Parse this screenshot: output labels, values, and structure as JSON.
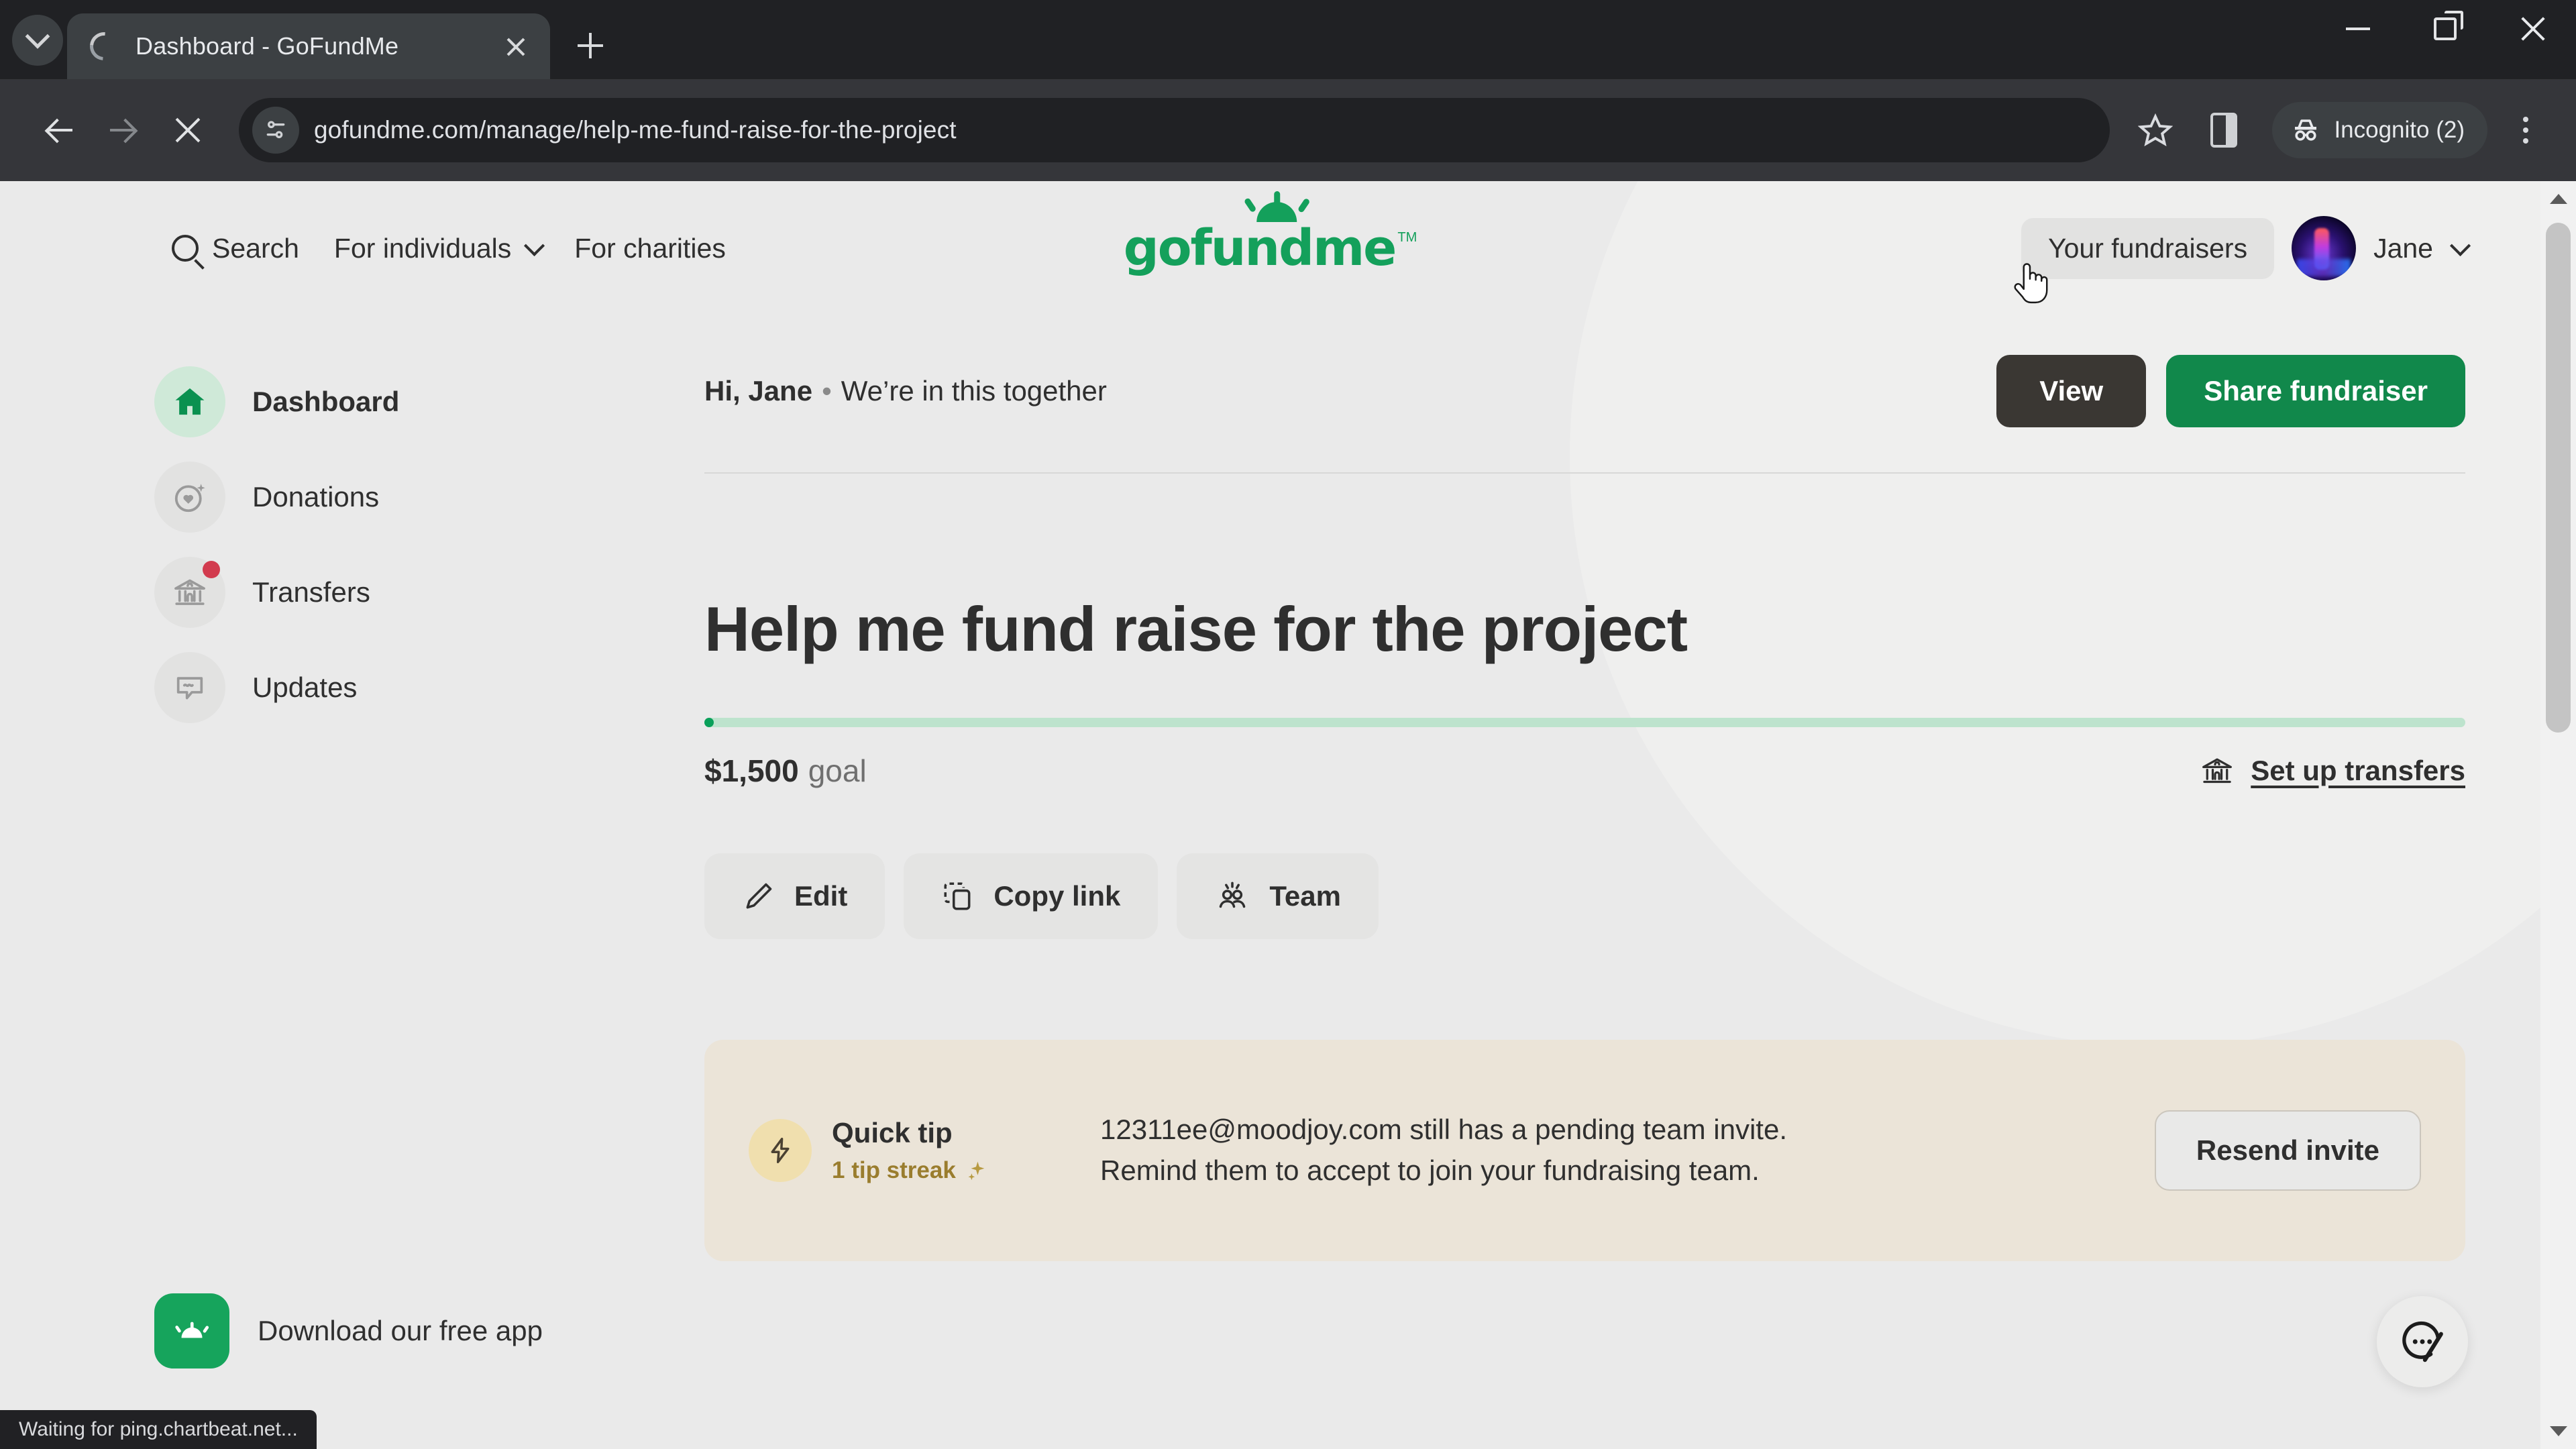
{
  "browser": {
    "tab": {
      "title": "Dashboard - GoFundMe",
      "loading": true
    },
    "new_tab_label": "+",
    "url": "gofundme.com/manage/help-me-fund-raise-for-the-project",
    "profile_pill": "Incognito (2)",
    "status_text": "Waiting for ping.chartbeat.net..."
  },
  "header": {
    "nav": [
      {
        "label": "Search",
        "icon": "search-icon"
      },
      {
        "label": "For individuals",
        "icon": "chevron-down-icon"
      },
      {
        "label": "For charities",
        "icon": ""
      }
    ],
    "logo_text": "gofundme",
    "logo_tm": "TM",
    "your_fundraisers": "Your fundraisers",
    "user_name": "Jane"
  },
  "sidebar": {
    "items": [
      {
        "label": "Dashboard",
        "icon": "home-icon",
        "active": true,
        "badge": false
      },
      {
        "label": "Donations",
        "icon": "donation-heart-icon",
        "active": false,
        "badge": false
      },
      {
        "label": "Transfers",
        "icon": "bank-icon",
        "active": false,
        "badge": true
      },
      {
        "label": "Updates",
        "icon": "comment-icon",
        "active": false,
        "badge": false
      }
    ],
    "app_promo": {
      "label": "Download our free app",
      "icon": "gofundme-app-icon"
    }
  },
  "main": {
    "greeting_name": "Hi, Jane",
    "greeting_separator": "•",
    "greeting_tagline": "We’re in this together",
    "view_label": "View",
    "share_label": "Share fundraiser",
    "title": "Help me fund raise for the project",
    "progress_percent": 0,
    "goal_amount": "$1,500",
    "goal_word": "goal",
    "transfers_link": "Set up transfers",
    "actions": [
      {
        "label": "Edit",
        "icon": "pencil-icon"
      },
      {
        "label": "Copy link",
        "icon": "copy-icon"
      },
      {
        "label": "Team",
        "icon": "people-icon"
      }
    ],
    "tip": {
      "heading": "Quick tip",
      "streak": "1 tip streak",
      "body": "12311ee@moodjoy.com still has a pending team invite. Remind them to accept to join your fundraising team.",
      "button": "Resend invite"
    }
  },
  "colors": {
    "brand_green": "#11884b",
    "logo_green": "#14a05b",
    "dark_button": "#3a3733",
    "page_bg": "#eaeaea",
    "tip_card_bg": "#ebe4d8",
    "badge_red": "#d23b4e"
  }
}
